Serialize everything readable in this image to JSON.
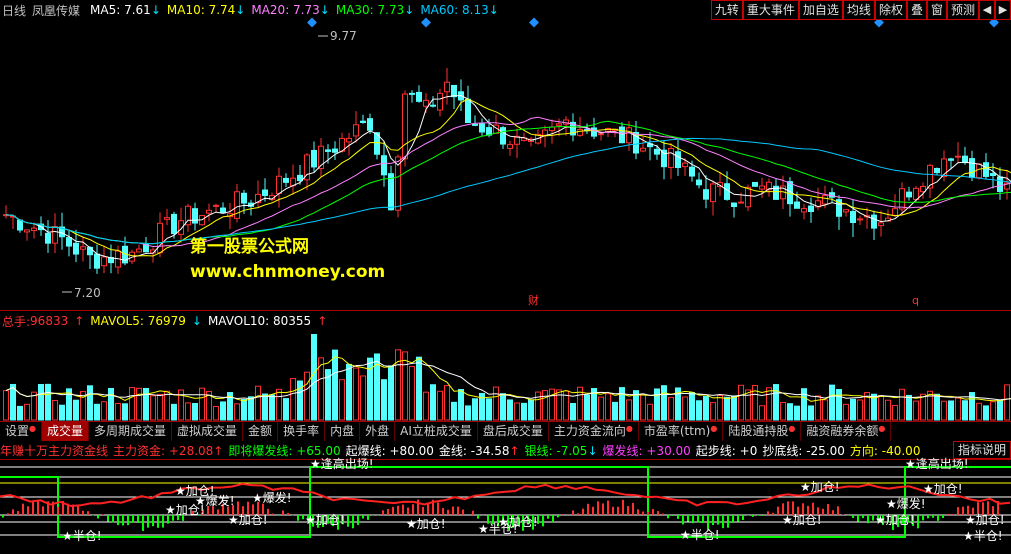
{
  "main_legend": {
    "period": "日线",
    "stock": "凤凰传媒",
    "ma": [
      {
        "label": "MA5: 7.61",
        "color": "#ffffff",
        "dir": "down"
      },
      {
        "label": "MA10: 7.74",
        "color": "#ffff00",
        "dir": "down"
      },
      {
        "label": "MA20: 7.73",
        "color": "#ff80ff",
        "dir": "down"
      },
      {
        "label": "MA30: 7.73",
        "color": "#00ff00",
        "dir": "down"
      },
      {
        "label": "MA60: 8.13",
        "color": "#00c8ff",
        "dir": "down"
      }
    ]
  },
  "toolbar": {
    "buttons": [
      "九转",
      "重大事件",
      "加自选",
      "均线",
      "除权",
      "叠",
      "窗",
      "预测"
    ],
    "icons": [
      "◀",
      "▶"
    ],
    "icon_names": [
      "scroll-left-icon",
      "scroll-right-icon"
    ]
  },
  "annotations": {
    "high_price": "9.77",
    "low_price": "7.20",
    "event_cai": "财",
    "event_q": "q"
  },
  "watermark": {
    "line1": "第一股票公式网",
    "line2": "www.chnmoney.com"
  },
  "volume_legend": {
    "total": {
      "label": "总手: ",
      "value": "96833",
      "dir": "up"
    },
    "mavol5": {
      "label": "MAVOL5: 76979",
      "dir": "down"
    },
    "mavol10": {
      "label": "MAVOL10: 80355",
      "dir": "up"
    }
  },
  "tabs": [
    {
      "label": "设置",
      "dot": true,
      "active": false
    },
    {
      "label": "成交量",
      "dot": false,
      "active": true
    },
    {
      "label": "多周期成交量",
      "dot": false,
      "active": false
    },
    {
      "label": "虚拟成交量",
      "dot": false,
      "active": false
    },
    {
      "label": "金额",
      "dot": false,
      "active": false
    },
    {
      "label": "换手率",
      "dot": false,
      "active": false
    },
    {
      "label": "内盘",
      "dot": false,
      "active": false
    },
    {
      "label": "外盘",
      "dot": false,
      "active": false
    },
    {
      "label": "AI立桩成交量",
      "dot": false,
      "active": false
    },
    {
      "label": "盘后成交量",
      "dot": false,
      "active": false
    },
    {
      "label": "主力资金流向",
      "dot": true,
      "active": false
    },
    {
      "label": "市盈率(ttm)",
      "dot": true,
      "active": false
    },
    {
      "label": "陆股通持股",
      "dot": true,
      "active": false
    },
    {
      "label": "融资融券余额",
      "dot": true,
      "active": false
    }
  ],
  "indicator_button": "指标说明",
  "indicator_legend": [
    {
      "text": "年赚十万主力资金线",
      "color": "#ff3030"
    },
    {
      "text": "主力资金: +28.08",
      "color": "#ff3030",
      "dir": "up"
    },
    {
      "text": "即将爆发线: +65.00",
      "color": "#00ff00"
    },
    {
      "text": "起爆线: +80.00",
      "color": "#ffffff"
    },
    {
      "text": "金线: -34.58",
      "color": "#ffffff",
      "dir": "up"
    },
    {
      "text": "银线: -7.05",
      "color": "#00ff00",
      "dir": "down"
    },
    {
      "text": "爆发线: +30.00",
      "color": "#ff40ff"
    },
    {
      "text": "起步线: +0",
      "color": "#ffffff"
    },
    {
      "text": "抄底线: -25.00",
      "color": "#ffffff"
    },
    {
      "text": "方向: -40.00",
      "color": "#ffff00"
    }
  ],
  "signals": {
    "add": "★加仓!",
    "burst": "★爆发!",
    "half": "★半仓!",
    "escape": "★逢高出场!"
  },
  "colors": {
    "up": "#ff3030",
    "down": "#54ffff",
    "separator": "#a00000"
  }
}
